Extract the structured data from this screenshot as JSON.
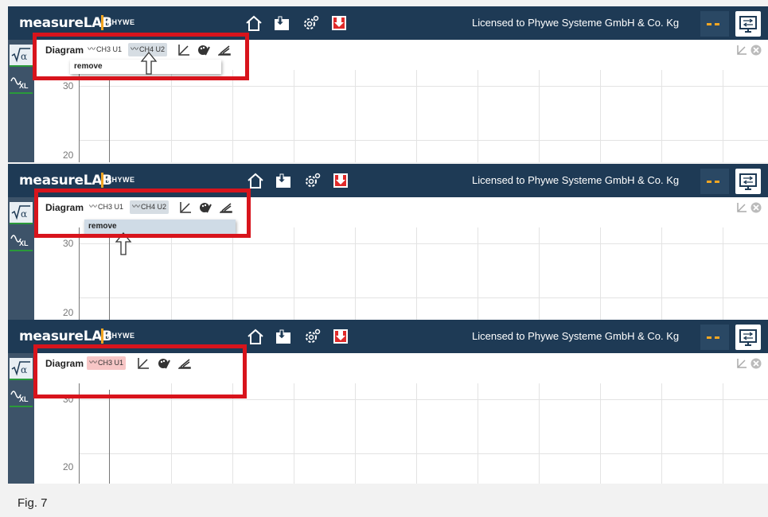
{
  "app": {
    "logo": "measureLAB",
    "brand": "PHYWE",
    "license": "Licensed to Phywe Systeme GmbH & Co. Kg"
  },
  "icons": [
    "home-icon",
    "open-folder-icon",
    "settings-gear-icon",
    "save-icon",
    "monitor-switch-icon",
    "sqrt-alpha-icon",
    "xl-wave-icon",
    "axis-icon",
    "palette-icon",
    "measure-icon",
    "close-icon"
  ],
  "colors": {
    "topbar": "#1e3a55",
    "accent": "#f2a623",
    "highlight_red": "#d8141c"
  },
  "panels": [
    {
      "diagram_label": "Diagram",
      "channels": [
        {
          "label": "CH3 U1",
          "state": "normal"
        },
        {
          "label": "CH4 U2",
          "state": "hover"
        }
      ],
      "context_menu": {
        "item": "remove",
        "active": false
      },
      "y_ticks": [
        "30",
        "20"
      ]
    },
    {
      "diagram_label": "Diagram",
      "channels": [
        {
          "label": "CH3 U1",
          "state": "normal"
        },
        {
          "label": "CH4 U2",
          "state": "hover"
        }
      ],
      "context_menu": {
        "item": "remove",
        "active": true
      },
      "y_ticks": [
        "30",
        "20"
      ]
    },
    {
      "diagram_label": "Diagram",
      "channels": [
        {
          "label": "CH3 U1",
          "state": "selected"
        }
      ],
      "context_menu": null,
      "y_ticks": [
        "30",
        "20"
      ]
    }
  ],
  "caption": "Fig. 7"
}
